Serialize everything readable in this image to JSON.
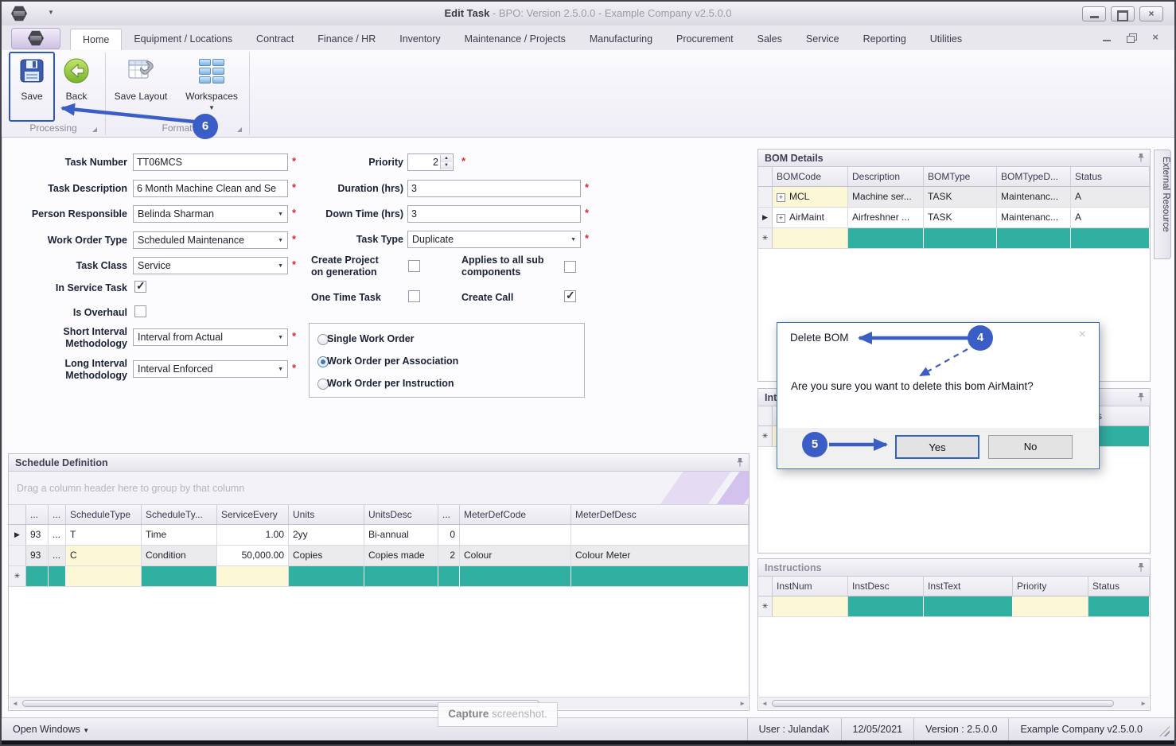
{
  "window": {
    "title_main": "Edit Task",
    "title_rest": " - BPO: Version 2.5.0.0 - Example Company v2.5.0.0"
  },
  "ribbon": {
    "tabs": [
      "Home",
      "Equipment / Locations",
      "Contract",
      "Finance / HR",
      "Inventory",
      "Maintenance / Projects",
      "Manufacturing",
      "Procurement",
      "Sales",
      "Service",
      "Reporting",
      "Utilities"
    ],
    "buttons": {
      "save": "Save",
      "back": "Back",
      "save_layout": "Save Layout",
      "workspaces": "Workspaces"
    },
    "groups": {
      "processing": "Processing",
      "format": "Format"
    }
  },
  "form": {
    "required_marker": "*",
    "task_number": {
      "label": "Task Number",
      "value": "TT06MCS"
    },
    "task_description": {
      "label": "Task Description",
      "value": "6 Month Machine Clean and Se"
    },
    "person_responsible": {
      "label": "Person Responsible",
      "value": "Belinda Sharman"
    },
    "work_order_type": {
      "label": "Work Order Type",
      "value": "Scheduled Maintenance"
    },
    "task_class": {
      "label": "Task Class",
      "value": "Service"
    },
    "in_service_task": {
      "label": "In Service Task"
    },
    "is_overhaul": {
      "label": "Is Overhaul"
    },
    "short_interval": {
      "label_line1": "Short Interval",
      "label_line2": "Methodology",
      "value": "Interval from Actual"
    },
    "long_interval": {
      "label_line1": "Long Interval",
      "label_line2": "Methodology",
      "value": "Interval Enforced"
    },
    "priority": {
      "label": "Priority",
      "value": "2"
    },
    "duration": {
      "label": "Duration (hrs)",
      "value": "3"
    },
    "down_time": {
      "label": "Down Time (hrs)",
      "value": "3"
    },
    "task_type": {
      "label": "Task Type",
      "value": "Duplicate"
    },
    "create_project": {
      "label_line1": "Create Project",
      "label_line2": "on generation"
    },
    "applies_sub": {
      "label_line1": "Applies to all sub",
      "label_line2": "components"
    },
    "one_time_task": {
      "label": "One Time Task"
    },
    "create_call": {
      "label": "Create Call"
    },
    "work_order_options": [
      "Single Work Order",
      "Work Order per Association",
      "Work Order per Instruction"
    ]
  },
  "schedule": {
    "title": "Schedule Definition",
    "group_hint": "Drag a column header here to group by that column",
    "columns": [
      "...",
      "...",
      "ScheduleType",
      "ScheduleTy...",
      "ServiceEvery",
      "Units",
      "UnitsDesc",
      "...",
      "MeterDefCode",
      "MeterDefDesc"
    ],
    "rows": [
      [
        "93",
        "...",
        "T",
        "Time",
        "1.00",
        "2yy",
        "Bi-annual",
        "0",
        "",
        ""
      ],
      [
        "93",
        "...",
        "C",
        "Condition",
        "50,000.00",
        "Copies",
        "Copies made",
        "2",
        "Colour",
        "Colour Meter"
      ]
    ]
  },
  "bom": {
    "title": "BOM Details",
    "columns": [
      "BOMCode",
      "Description",
      "BOMType",
      "BOMTypeD...",
      "Status"
    ],
    "rows": [
      [
        "MCL",
        "Machine ser...",
        "TASK",
        "Maintenanc...",
        "A"
      ],
      [
        "AirMaint",
        "Airfreshner ...",
        "TASK",
        "Maintenanc...",
        "A"
      ]
    ]
  },
  "int_panel": {
    "title": "Int",
    "status_column": "Status"
  },
  "instructions": {
    "title": "Instructions",
    "columns": [
      "InstNum",
      "InstDesc",
      "InstText",
      "Priority",
      "Status"
    ]
  },
  "external_tab": "External Resource",
  "dialog": {
    "title": "Delete BOM",
    "message": "Are you sure you want to delete this bom AirMaint?",
    "yes_label": "Yes",
    "no_label": "No"
  },
  "annotations": {
    "step4": "4",
    "step5": "5",
    "step6": "6"
  },
  "statusbar": {
    "open_windows": "Open Windows",
    "user": "User : JulandaK",
    "date": "12/05/2021",
    "version": "Version : 2.5.0.0",
    "company": "Example Company v2.5.0.0"
  },
  "tooltip": {
    "bold": "Capture",
    "rest": " screenshot."
  },
  "icons": {
    "dropdown_caret": "▼",
    "spinner_up": "▲",
    "spinner_down": "▼",
    "check": "✓",
    "current_row": "▶",
    "new_row": "✳",
    "expand": "+",
    "close_x": "×",
    "scroll_left": "◄",
    "scroll_right": "►",
    "open_windows_caret": "▼"
  },
  "colors": {
    "teal": "#2fb0a0",
    "annotation_blue": "#3a5ec6",
    "cream": "#fcf8d6",
    "required_red": "#e02828"
  }
}
